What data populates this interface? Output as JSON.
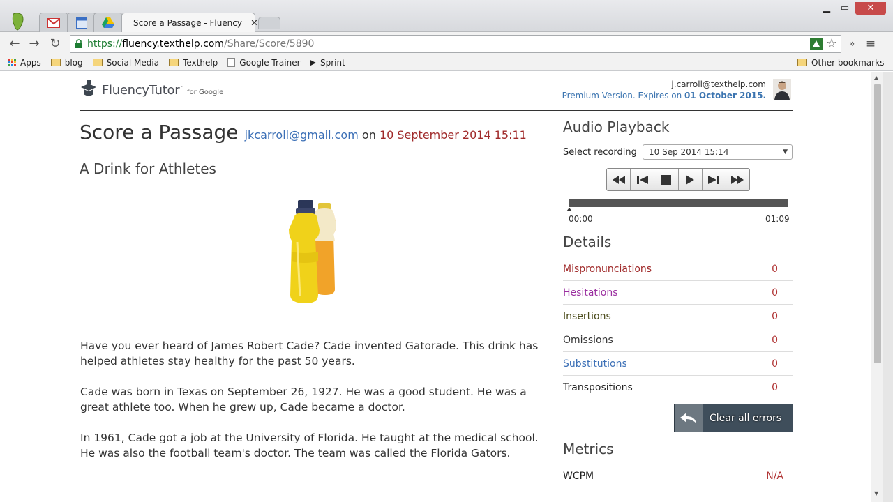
{
  "browser": {
    "tabs": [
      {
        "title": "",
        "icon": "evernote-icon"
      },
      {
        "title": "",
        "icon": "gmail-icon"
      },
      {
        "title": "",
        "icon": "calendar-icon"
      },
      {
        "title": "",
        "icon": "drive-icon"
      },
      {
        "title": "Score a Passage - Fluency",
        "icon": "fluency-icon"
      }
    ],
    "url": {
      "scheme": "https://",
      "host": "fluency.texthelp.com",
      "path": "/Share/Score/5890"
    },
    "bookmarks": [
      "Apps",
      "blog",
      "Social Media",
      "Texthelp",
      "Google Trainer",
      "Sprint"
    ],
    "other_bookmarks": "Other bookmarks",
    "more_label": "»"
  },
  "header": {
    "logo_text": "FluencyTutor",
    "logo_tm": "™",
    "logo_sub": "for Google",
    "user_email": "j.carroll@texthelp.com",
    "premium_text": "Premium Version. Expires on ",
    "premium_date": "01 October 2015."
  },
  "main": {
    "title": "Score a Passage",
    "student_email": "jkcarroll@gmail.com",
    "on": "on",
    "date": "10 September 2014 15:11",
    "passage_title": "A Drink for Athletes",
    "paragraphs": [
      "Have you ever heard of James Robert Cade? Cade invented Gatorade. This drink has helped athletes stay healthy for the past 50 years.",
      "Cade was born in Texas on September 26, 1927. He was a good student. He was a great athlete too. When he grew up, Cade became a doctor.",
      "In 1961, Cade got a job at the University of Florida. He taught at the medical school. He was also the football team's doctor. The team was called the Florida Gators."
    ]
  },
  "audio": {
    "heading": "Audio Playback",
    "select_label": "Select recording",
    "selected_recording": "10 Sep 2014 15:14",
    "time_start": "00:00",
    "time_end": "01:09",
    "progress": 0
  },
  "details": {
    "heading": "Details",
    "rows": [
      {
        "label": "Mispronunciations",
        "value": "0",
        "color": "#a02a2a"
      },
      {
        "label": "Hesitations",
        "value": "0",
        "color": "#9b2fa0"
      },
      {
        "label": "Insertions",
        "value": "0",
        "color": "#4a4a1a"
      },
      {
        "label": "Omissions",
        "value": "0",
        "color": "#333333"
      },
      {
        "label": "Substitutions",
        "value": "0",
        "color": "#3b6fb6"
      },
      {
        "label": "Transpositions",
        "value": "0",
        "color": "#222222"
      }
    ],
    "clear_label": "Clear all errors"
  },
  "metrics": {
    "heading": "Metrics",
    "rows": [
      {
        "label": "WCPM",
        "value": "N/A"
      }
    ]
  }
}
